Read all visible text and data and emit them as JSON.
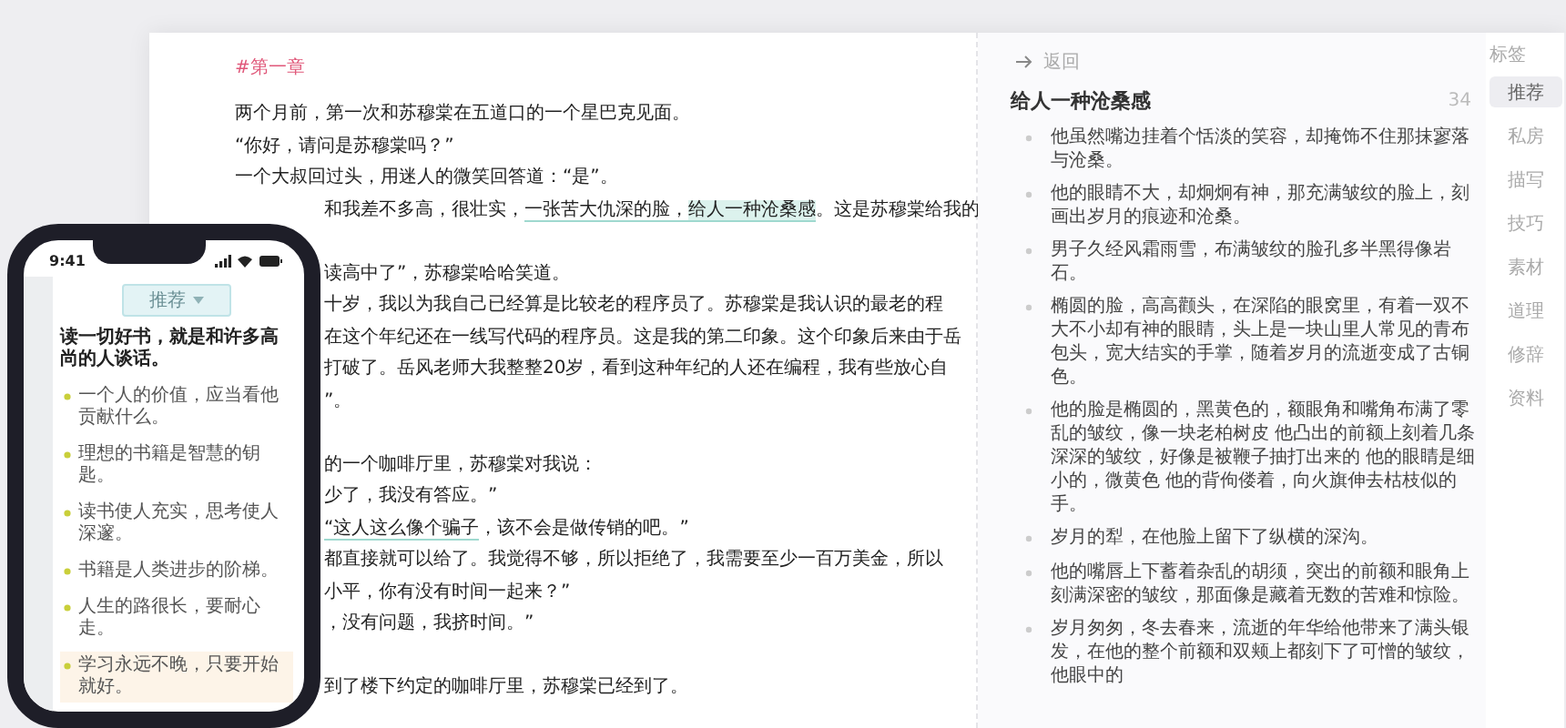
{
  "editor": {
    "heading": "#第一章",
    "lines": [
      {
        "kind": "text",
        "segments": [
          {
            "text": "两个月前，第一次和苏穆棠在五道口的一个星巴克见面。"
          }
        ]
      },
      {
        "kind": "text",
        "segments": [
          {
            "text": "“你好，请问是苏穆棠吗？”"
          }
        ]
      },
      {
        "kind": "text",
        "segments": [
          {
            "text": "一个大叔回过头，用迷人的微笑回答道：“是”。"
          }
        ]
      }
    ],
    "lines_beside_phone": [
      {
        "kind": "text",
        "segments": [
          {
            "text": "和我差不多高，很壮实，"
          },
          {
            "text": "一张苦大仇深的脸，",
            "underlined": true,
            "highlighted": false
          },
          {
            "text": "给人一种沧桑感",
            "underlined": true,
            "highlighted": true
          },
          {
            "text": "。这是苏穆棠给我的"
          }
        ]
      },
      {
        "kind": "break"
      },
      {
        "kind": "text",
        "segments": [
          {
            "text": "读高中了”，苏穆棠哈哈笑道。"
          }
        ]
      },
      {
        "kind": "text",
        "segments": [
          {
            "text": "十岁，我以为我自己已经算是比较老的程序员了。苏穆棠是我认识的最老的程"
          }
        ]
      },
      {
        "kind": "text",
        "segments": [
          {
            "text": "在这个年纪还在一线写代码的程序员。这是我的第二印象。这个印象后来由于岳"
          }
        ]
      },
      {
        "kind": "text",
        "segments": [
          {
            "text": "打破了。岳风老师大我整整20岁，看到这种年纪的人还在编程，我有些放心自"
          }
        ]
      },
      {
        "kind": "text",
        "segments": [
          {
            "text": "”。"
          }
        ]
      },
      {
        "kind": "break"
      },
      {
        "kind": "text",
        "segments": [
          {
            "text": "的一个咖啡厅里，苏穆棠对我说："
          }
        ]
      },
      {
        "kind": "text",
        "segments": [
          {
            "text": "少了，我没有答应。”"
          }
        ]
      },
      {
        "kind": "text",
        "segments": [
          {
            "text": "“这人这么像个骗子",
            "underlined": true,
            "highlighted": false
          },
          {
            "text": "，该不会是做传销的吧。”"
          }
        ]
      },
      {
        "kind": "text",
        "segments": [
          {
            "text": "都直接就可以给了。我觉得不够，所以拒绝了，我需要至少一百万美金，所以"
          }
        ]
      },
      {
        "kind": "text",
        "segments": [
          {
            "text": "小平，你有没有时间一起来？”"
          }
        ]
      },
      {
        "kind": "text",
        "segments": [
          {
            "text": "，没有问题，我挤时间。”"
          }
        ]
      },
      {
        "kind": "break"
      },
      {
        "kind": "text",
        "segments": [
          {
            "text": "到了楼下约定的咖啡厅里，苏穆棠已经到了。"
          }
        ]
      }
    ]
  },
  "notes": {
    "back": "返回",
    "title": "给人一种沧桑感",
    "count": "34",
    "items": [
      "他虽然嘴边挂着个恬淡的笑容，却掩饰不住那抹寥落与沧桑。",
      "他的眼睛不大，却炯炯有神，那充满皱纹的脸上，刻画出岁月的痕迹和沧桑。",
      "男子久经风霜雨雪，布满皱纹的脸孔多半黑得像岩石。",
      "椭圆的脸，高高颧头，在深陷的眼窝里，有着一双不大不小却有神的眼睛，头上是一块山里人常见的青布包头，宽大结实的手掌，随着岁月的流逝变成了古铜色。",
      "他的脸是椭圆的，黑黄色的，额眼角和嘴角布满了零乱的皱纹，像一块老柏树皮 他凸出的前额上刻着几条深深的皱纹，好像是被鞭子抽打出来的 他的眼睛是细小的，微黄色 他的背佝偻着，向火旗伸去枯枝似的手。",
      "岁月的犁，在他脸上留下了纵横的深沟。",
      "他的嘴唇上下蓄着杂乱的胡须，突出的前额和眼角上刻满深密的皱纹，那面像是藏着无数的苦难和惊险。",
      "岁月匆匆，冬去春来，流逝的年华给他带来了满头银发，在他的整个前额和双颊上都刻下了可憎的皱纹，他眼中的"
    ]
  },
  "tags": {
    "title": "标签",
    "items": [
      {
        "label": "推荐",
        "selected": true
      },
      {
        "label": "私房",
        "selected": false
      },
      {
        "label": "描写",
        "selected": false
      },
      {
        "label": "技巧",
        "selected": false
      },
      {
        "label": "素材",
        "selected": false
      },
      {
        "label": "道理",
        "selected": false
      },
      {
        "label": "修辞",
        "selected": false
      },
      {
        "label": "资料",
        "selected": false
      }
    ]
  },
  "phone": {
    "time": "9:41",
    "tag": "推荐",
    "heading": "读一切好书，就是和许多高尚的人谈话。",
    "items": [
      {
        "text": "一个人的价值，应当看他贡献什么。",
        "highlighted": false
      },
      {
        "text": "理想的书籍是智慧的钥匙。",
        "highlighted": false
      },
      {
        "text": "读书使人充实，思考使人深邃。",
        "highlighted": false
      },
      {
        "text": "书籍是人类进步的阶梯。",
        "highlighted": false
      },
      {
        "text": "人生的路很长，要耐心走。",
        "highlighted": false
      },
      {
        "text": "学习永远不晚，只要开始就好。",
        "highlighted": true
      }
    ]
  }
}
